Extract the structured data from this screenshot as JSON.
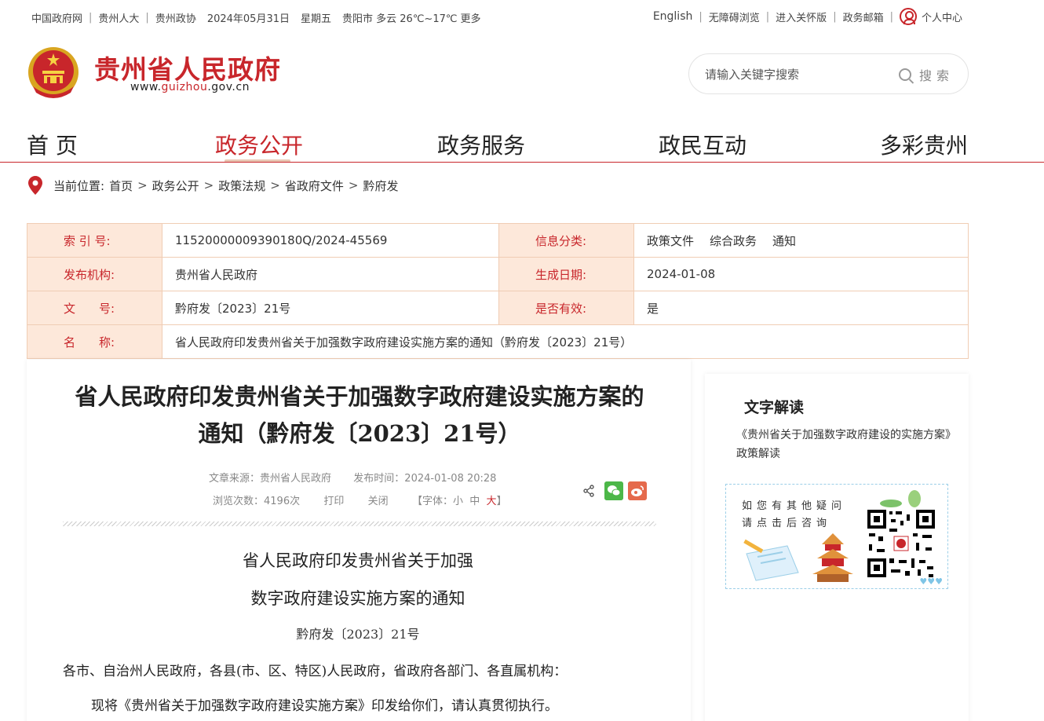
{
  "topbar": {
    "left_links": [
      "中国政府网",
      "贵州人大",
      "贵州政协"
    ],
    "date": "2024年05月31日",
    "weekday": "星期五",
    "weather": "贵阳市 多云 26℃~17℃",
    "weather_more": "更多",
    "right_links": [
      "English",
      "无障碍浏览",
      "进入关怀版",
      "政务邮箱"
    ],
    "user_center": "个人中心"
  },
  "header": {
    "site_name": "贵州省人民政府",
    "url_prefix": "www.",
    "url_brand": "guizhou",
    "url_suffix": ".gov.cn",
    "search_placeholder": "请输入关键字搜索",
    "search_button": "搜索"
  },
  "nav": {
    "items": [
      "首 页",
      "政务公开",
      "政务服务",
      "政民互动",
      "多彩贵州"
    ],
    "active_index": 1
  },
  "breadcrumb": {
    "label": "当前位置:",
    "items": [
      "首页",
      "政务公开",
      "政策法规",
      "省政府文件",
      "黔府发"
    ],
    "separator": ">"
  },
  "info": {
    "index_label": "索 引 号:",
    "index_value": "11520000009390180Q/2024-45569",
    "category_label": "信息分类:",
    "category_values": [
      "政策文件",
      "综合政务",
      "通知"
    ],
    "publisher_label": "发布机构:",
    "publisher_value": "贵州省人民政府",
    "date_label": "生成日期:",
    "date_value": "2024-01-08",
    "doc_label": "文　　号:",
    "doc_value": "黔府发〔2023〕21号",
    "valid_label": "是否有效:",
    "valid_value": "是",
    "name_label": "名　　称:",
    "name_value": "省人民政府印发贵州省关于加强数字政府建设实施方案的通知（黔府发〔2023〕21号）"
  },
  "article": {
    "title_line1": "省人民政府印发贵州省关于加强数字政府建设实施方案的",
    "title_line2": "通知（黔府发〔2023〕21号）",
    "source": "文章来源：贵州省人民政府",
    "publish_time": "发布时间：2024-01-08 20:28",
    "views": "浏览次数：4196次",
    "print": "打印",
    "close": "关闭",
    "font_label": "【字体：",
    "font_small": "小",
    "font_medium": "中",
    "font_large": "大",
    "font_end": "】",
    "body_title_line1": "省人民政府印发贵州省关于加强",
    "body_title_line2": "数字政府建设实施方案的通知",
    "doc_number": "黔府发〔2023〕21号",
    "para1": "各市、自治州人民政府，各县(市、区、特区)人民政府，省政府各部门、各直属机构：",
    "para2": "现将《贵州省关于加强数字政府建设实施方案》印发给你们，请认真贯彻执行。"
  },
  "side": {
    "title": "文字解读",
    "link": "《贵州省关于加强数字政府建设的实施方案》政策解读",
    "qa_line1": "如您有其他疑问",
    "qa_line2": "请点击后咨询"
  },
  "colors": {
    "brand_red": "#c8262b",
    "label_bg": "#fde8da",
    "table_border": "#f0cdb4"
  }
}
